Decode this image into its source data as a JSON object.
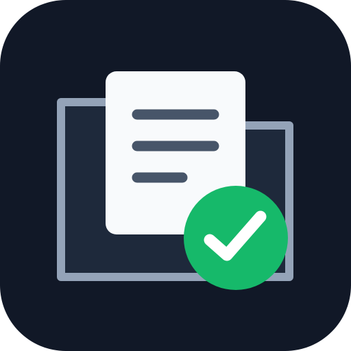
{
  "icon": {
    "name": "document-approved-app-icon",
    "depicts": [
      "folder-icon",
      "document-icon",
      "checkmark-badge-icon"
    ]
  },
  "colors": {
    "background": "#111827",
    "folder_fill": "#1E293B",
    "folder_border": "#94A3B8",
    "document_fill": "#F8FAFC",
    "document_lines": "#475569",
    "badge_fill": "#16B96A",
    "checkmark": "#FFFFFF"
  }
}
